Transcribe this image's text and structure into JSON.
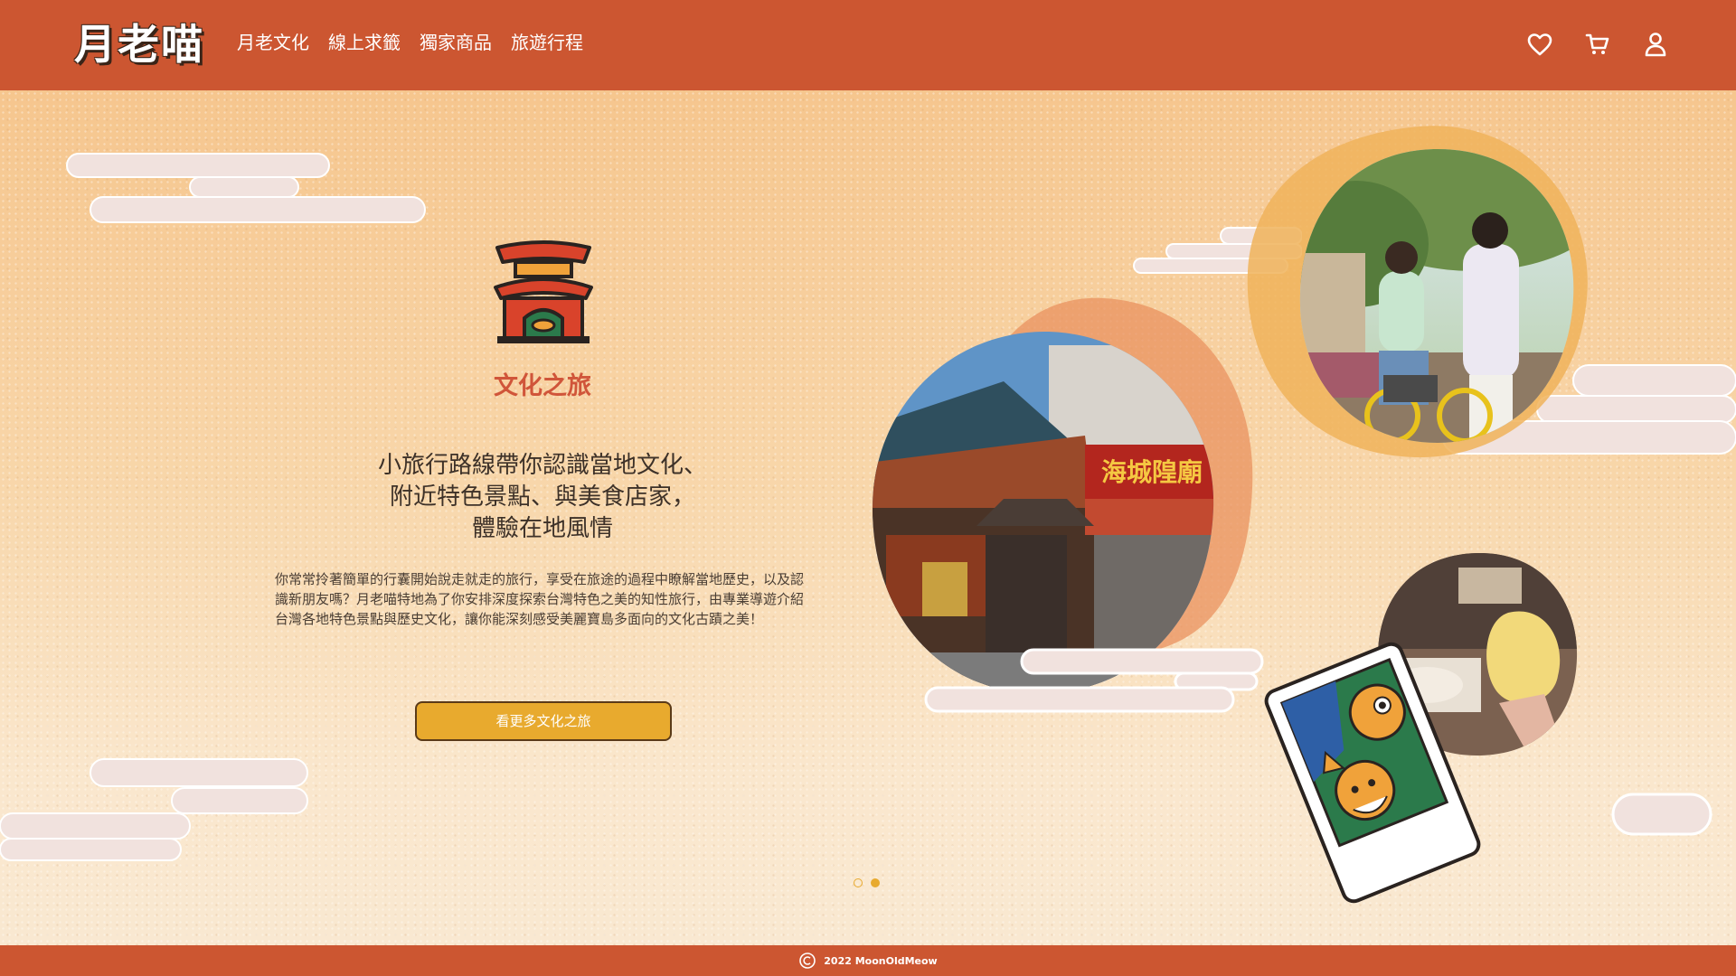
{
  "brand": {
    "logo_text": "月老喵"
  },
  "nav": {
    "items": [
      {
        "label": "月老文化"
      },
      {
        "label": "線上求籤"
      },
      {
        "label": "獨家商品"
      },
      {
        "label": "旅遊行程"
      }
    ]
  },
  "header_icons": [
    "heart-icon",
    "cart-icon",
    "user-icon"
  ],
  "hero": {
    "section_title": "文化之旅",
    "headline_lines": [
      "小旅行路線帶你認識當地文化、",
      "附近特色景點、與美食店家，",
      "體驗在地風情"
    ],
    "description": "你常常拎著簡單的行囊開始說走就走的旅行，享受在旅途的過程中瞭解當地歷史，以及認識新朋友嗎？月老喵特地為了你安排深度探索台灣特色之美的知性旅行，由專業導遊介紹台灣各地特色景點與歷史文化，讓你能深刻感受美麗寶島多面向的文化古蹟之美！",
    "cta_label": "看更多文化之旅",
    "temple_sign_text": "海城隍廟",
    "carousel": {
      "total": 2,
      "active": 2
    }
  },
  "footer": {
    "copyright": "2022 MoonOldMeow"
  },
  "colors": {
    "primary": "#cc5631",
    "accent": "#e8aa2e",
    "title_red": "#d0553a",
    "background": "#f6d3a6"
  }
}
